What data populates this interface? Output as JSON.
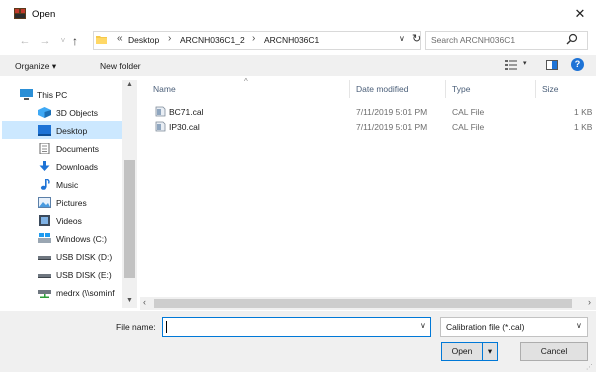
{
  "window": {
    "title": "Open",
    "close_glyph": "✕",
    "title_icon": "app-icon",
    "accent": "#0078d7"
  },
  "address": {
    "back": "←",
    "forward": "→",
    "history": "˅",
    "up": "↑",
    "chevron": "«",
    "crumbs": [
      "Desktop",
      "ARCNH036C1_2",
      "ARCNH036C1"
    ],
    "separator": "›",
    "dropdown": "∨",
    "refresh": "↻",
    "search_placeholder": "Search ARCNH036C1"
  },
  "toolbar": {
    "organize": "Organize ▾",
    "new_folder": "New folder",
    "view_dropdown": "▾"
  },
  "nav": {
    "items": [
      {
        "label": "This PC",
        "icon": "pc-icon"
      },
      {
        "label": "3D Objects",
        "icon": "3d-objects-icon"
      },
      {
        "label": "Desktop",
        "icon": "desktop-icon"
      },
      {
        "label": "Documents",
        "icon": "documents-icon"
      },
      {
        "label": "Downloads",
        "icon": "downloads-icon"
      },
      {
        "label": "Music",
        "icon": "music-icon"
      },
      {
        "label": "Pictures",
        "icon": "pictures-icon"
      },
      {
        "label": "Videos",
        "icon": "videos-icon"
      },
      {
        "label": "Windows (C:)",
        "icon": "drive-icon"
      },
      {
        "label": "USB DISK (D:)",
        "icon": "usb-drive-icon"
      },
      {
        "label": "USB DISK (E:)",
        "icon": "usb-drive-icon"
      },
      {
        "label": "medrx (\\\\sominf",
        "icon": "network-drive-icon"
      }
    ],
    "selected": "Desktop",
    "scroll_up": "▲",
    "scroll_down": "▼"
  },
  "files": {
    "columns": [
      "Name",
      "Date modified",
      "Type",
      "Size"
    ],
    "sort_caret": "^",
    "rows": [
      {
        "name": "BC71.cal",
        "date": "7/11/2019 5:01 PM",
        "type": "CAL File",
        "size": "1 KB"
      },
      {
        "name": "IP30.cal",
        "date": "7/11/2019 5:01 PM",
        "type": "CAL File",
        "size": "1 KB"
      }
    ],
    "scroll_left": "‹",
    "scroll_right": "›"
  },
  "footer": {
    "file_name_label": "File name:",
    "file_name_value": "",
    "file_name_dropdown": "∨",
    "file_type": "Calibration file (*.cal)",
    "file_type_dropdown": "∨",
    "open_label": "Open",
    "open_split": "▾",
    "cancel_label": "Cancel",
    "grip": "⋰"
  }
}
